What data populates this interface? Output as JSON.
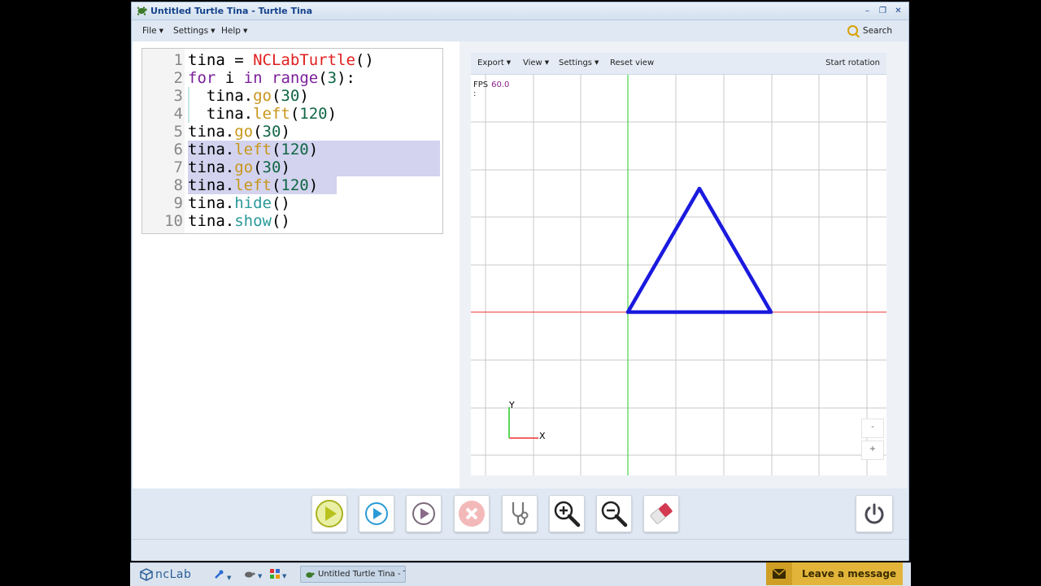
{
  "window": {
    "title": "Untitled Turtle Tina - Turtle Tina",
    "controls": [
      "–",
      "❐",
      "✕"
    ]
  },
  "menubar": {
    "items": [
      "File",
      "Settings",
      "Help"
    ],
    "search_label": "Search"
  },
  "editor": {
    "lines": [
      {
        "n": "1",
        "tokens": [
          [
            "tina = ",
            ""
          ],
          [
            "NCLabTurtle",
            "cls"
          ],
          [
            "()",
            ""
          ]
        ]
      },
      {
        "n": "2",
        "tokens": [
          [
            "for",
            "k"
          ],
          [
            " i ",
            ""
          ],
          [
            "in",
            "k"
          ],
          [
            " ",
            ""
          ],
          [
            "range",
            "k"
          ],
          [
            "(",
            ""
          ],
          [
            "3",
            "num"
          ],
          "):"
        ]
      },
      {
        "n": "3",
        "tokens": [
          [
            "  tina.",
            ""
          ],
          [
            "go",
            "meth"
          ],
          [
            "(",
            ""
          ],
          [
            "30",
            "num"
          ],
          [
            ")",
            ""
          ]
        ]
      },
      {
        "n": "4",
        "tokens": [
          [
            "  tina.",
            ""
          ],
          [
            "left",
            "meth"
          ],
          [
            "(",
            ""
          ],
          [
            "120",
            "num"
          ],
          [
            ")",
            ""
          ]
        ]
      },
      {
        "n": "5",
        "tokens": [
          [
            "tina.",
            ""
          ],
          [
            "go",
            "meth"
          ],
          [
            "(",
            ""
          ],
          [
            "30",
            "num"
          ],
          [
            ")",
            ""
          ]
        ]
      },
      {
        "n": "6",
        "tokens": [
          [
            "tina.",
            ""
          ],
          [
            "left",
            "meth"
          ],
          [
            "(",
            ""
          ],
          [
            "120",
            "num"
          ],
          [
            ")",
            ""
          ]
        ],
        "selected": true
      },
      {
        "n": "7",
        "tokens": [
          [
            "tina.",
            ""
          ],
          [
            "go",
            "meth"
          ],
          [
            "(",
            ""
          ],
          [
            "30",
            "num"
          ],
          [
            ")",
            ""
          ]
        ],
        "selected": true
      },
      {
        "n": "8",
        "tokens": [
          [
            "tina.",
            ""
          ],
          [
            "left",
            "meth"
          ],
          [
            "(",
            ""
          ],
          [
            "120",
            "num"
          ],
          [
            ")",
            ""
          ]
        ],
        "selected": true,
        "partial": true
      },
      {
        "n": "9",
        "tokens": [
          [
            "tina.",
            ""
          ],
          [
            "hide",
            "meth2"
          ],
          [
            "()",
            ""
          ]
        ]
      },
      {
        "n": "10",
        "tokens": [
          [
            "tina.",
            ""
          ],
          [
            "show",
            "meth2"
          ],
          [
            "()",
            ""
          ]
        ]
      }
    ]
  },
  "viewer": {
    "menu": [
      "Export",
      "View",
      "Settings"
    ],
    "reset_label": "Reset view",
    "rotation_label": "Start rotation",
    "fps_label": "FPS",
    "fps_sep": ":",
    "fps_value": "60.0",
    "axis_x": "X",
    "axis_y": "Y",
    "zoom_minus": "-",
    "zoom_plus": "+"
  },
  "toolbar": {
    "buttons": [
      "run",
      "step",
      "debug-play",
      "stop",
      "stethoscope",
      "zoom-in",
      "zoom-out",
      "eraser"
    ],
    "power": "power"
  },
  "taskbar": {
    "brand": "ncLab",
    "task_label": "Untitled Turtle Tina - Tu",
    "leave_message": "Leave a message"
  },
  "colors": {
    "triangle": "#1a1adf",
    "x_axis": "#e33",
    "y_axis": "#2c2"
  }
}
